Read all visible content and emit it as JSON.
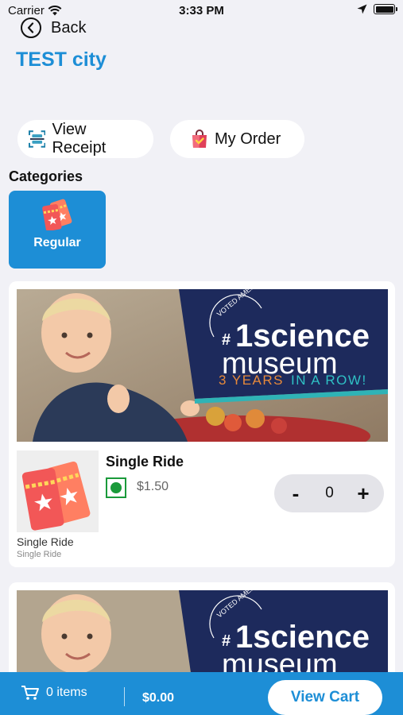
{
  "status_bar": {
    "carrier": "Carrier",
    "time": "3:33 PM"
  },
  "nav": {
    "back_label": "Back",
    "city_title": "TEST city"
  },
  "actions": {
    "view_receipt": "View Receipt",
    "my_order": "My Order"
  },
  "categories": {
    "title": "Categories",
    "items": [
      {
        "label": "Regular",
        "icon": "ticket-icon",
        "selected": true
      }
    ]
  },
  "banner": {
    "small_text": "VOTED AMERICA'S",
    "number": "#",
    "line1": "1science",
    "line2": "museum",
    "tagline_a": "3 YEARS",
    "tagline_b": "IN A ROW!"
  },
  "products": [
    {
      "name": "Single Ride",
      "price": "$1.50",
      "quantity": "0",
      "thumb_name": "Single Ride",
      "thumb_desc": "Single Ride",
      "decrement": "-",
      "increment": "+"
    }
  ],
  "cart": {
    "items": "0 items",
    "total": "$0.00",
    "button": "View Cart"
  },
  "colors": {
    "accent": "#1d8ed6",
    "veg": "#1a9a3a",
    "background": "#f1f1f6"
  }
}
